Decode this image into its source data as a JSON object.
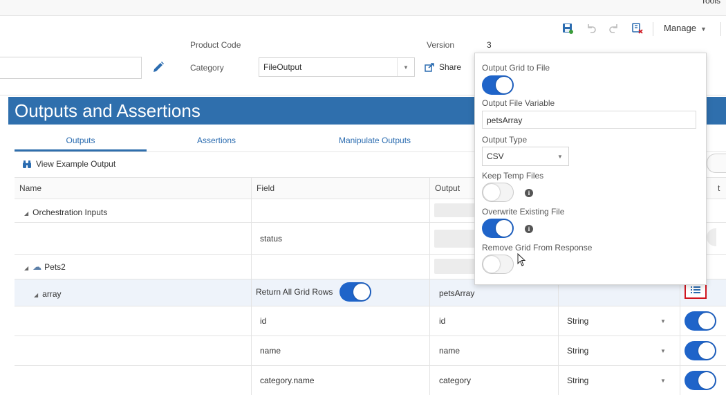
{
  "top": {
    "tools_label": "Tools"
  },
  "toolbar": {
    "save_icon": "save-icon",
    "undo_icon": "undo-icon",
    "redo_icon": "redo-icon",
    "delete_icon": "delete-icon",
    "manage_label": "Manage"
  },
  "header": {
    "product_code_label": "Product Code",
    "version_label": "Version",
    "version_value": "3",
    "category_label": "Category",
    "category_value": "FileOutput",
    "share_label": "Share"
  },
  "panel": {
    "title": "Outputs and Assertions",
    "tabs": [
      {
        "label": "Outputs",
        "active": true
      },
      {
        "label": "Assertions",
        "active": false
      },
      {
        "label": "Manipulate Outputs",
        "active": false
      }
    ],
    "view_example_label": "View Example Output"
  },
  "grid": {
    "columns": {
      "name": "Name",
      "field": "Field",
      "output": "Output",
      "last": "t"
    },
    "rows": {
      "orchestration_inputs": "Orchestration Inputs",
      "status": "status",
      "pets2": "Pets2",
      "array": "array",
      "return_all_label": "Return All Grid Rows",
      "array_output": "petsArray",
      "id_field": "id",
      "id_output": "id",
      "id_type": "String",
      "name_field": "name",
      "name_output": "name",
      "name_type": "String",
      "category_field": "category.name",
      "category_output": "category",
      "category_type": "String"
    }
  },
  "popup": {
    "output_grid_label": "Output Grid to File",
    "output_grid_on": true,
    "file_variable_label": "Output File Variable",
    "file_variable_value": "petsArray",
    "output_type_label": "Output Type",
    "output_type_value": "CSV",
    "keep_temp_label": "Keep Temp Files",
    "keep_temp_on": false,
    "overwrite_label": "Overwrite Existing File",
    "overwrite_on": true,
    "remove_grid_label": "Remove Grid From Response",
    "remove_grid_on": false
  },
  "colors": {
    "accent": "#2f6fad",
    "toggle_on": "#1f64c9",
    "highlight": "#d0141e"
  }
}
